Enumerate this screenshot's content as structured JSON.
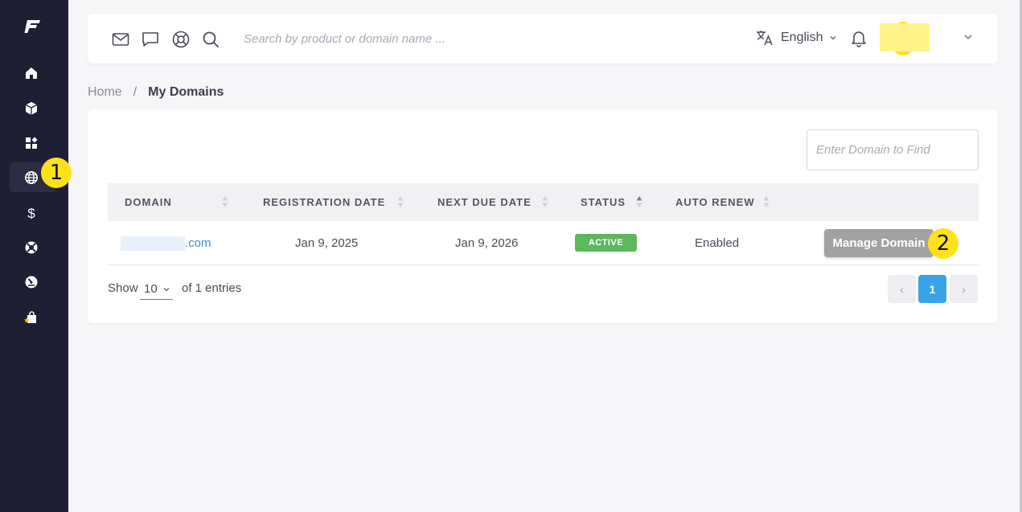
{
  "header": {
    "search": {
      "placeholder": "Search by product or domain name ..."
    },
    "language": "English",
    "icons": [
      "mail-icon",
      "chat-icon",
      "support-icon",
      "search-icon",
      "translate-icon",
      "bell-icon",
      "chevron-down-icon"
    ]
  },
  "sidebar": {
    "items": [
      {
        "icon": "home-icon",
        "active": false
      },
      {
        "icon": "box-icon",
        "active": false
      },
      {
        "icon": "apps-icon",
        "active": false
      },
      {
        "icon": "globe-icon",
        "active": true
      },
      {
        "icon": "dollar-icon",
        "active": false
      },
      {
        "icon": "lifebuoy-icon",
        "active": false
      },
      {
        "icon": "gauge-icon",
        "active": false
      },
      {
        "icon": "shop-bag-icon",
        "active": false
      }
    ]
  },
  "markers": {
    "one": "1",
    "two": "2"
  },
  "breadcrumb": {
    "home": "Home",
    "separator": "/",
    "current": "My Domains"
  },
  "filter": {
    "placeholder": "Enter Domain to Find"
  },
  "table": {
    "columns": [
      "DOMAIN",
      "REGISTRATION DATE",
      "NEXT DUE DATE",
      "STATUS",
      "AUTO RENEW"
    ],
    "rows": [
      {
        "domain_suffix": ".com",
        "registration_date": "Jan 9, 2025",
        "next_due_date": "Jan 9, 2026",
        "status": "ACTIVE",
        "auto_renew": "Enabled",
        "action": "Manage Domain"
      }
    ]
  },
  "footer": {
    "show_label": "Show",
    "page_size": "10",
    "entries_label": "of 1 entries",
    "prev": "‹",
    "current_page": "1",
    "next": "›"
  },
  "colors": {
    "sidebar": "#1f1f33",
    "accent": "#3aa3e8",
    "link": "#3a8fd8",
    "active_badge": "#5cb85c",
    "marker": "#ffe11a",
    "manage_button": "#a2a2a2"
  }
}
